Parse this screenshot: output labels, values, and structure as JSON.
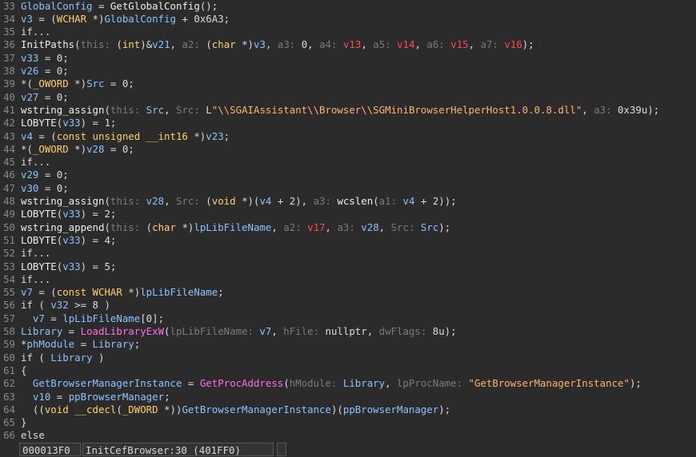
{
  "code_lines": [
    {
      "n": "33",
      "t": [
        [
          "GlobalConfig",
          "var"
        ],
        [
          " = ",
          ""
        ],
        [
          "GetGlobalConfig",
          "func"
        ],
        [
          "();",
          ""
        ]
      ]
    },
    {
      "n": "34",
      "t": [
        [
          "v3",
          "var"
        ],
        [
          " = (",
          ""
        ],
        [
          "WCHAR",
          "type"
        ],
        [
          " *)",
          ""
        ],
        [
          "GlobalConfig",
          "var"
        ],
        [
          " + 0x6A3;",
          ""
        ]
      ]
    },
    {
      "n": "35",
      "t": [
        [
          "if...",
          ""
        ]
      ]
    },
    {
      "n": "36",
      "t": [
        [
          "InitPaths",
          "func"
        ],
        [
          "(",
          ""
        ],
        [
          "this: ",
          "p"
        ],
        [
          "(",
          ""
        ],
        [
          "int",
          "type"
        ],
        [
          ")&",
          ""
        ],
        [
          "v21",
          "var"
        ],
        [
          ", ",
          ""
        ],
        [
          "a2: ",
          "p"
        ],
        [
          "(",
          ""
        ],
        [
          "char",
          "type"
        ],
        [
          " *)",
          ""
        ],
        [
          "v3",
          "var"
        ],
        [
          ", ",
          ""
        ],
        [
          "a3: ",
          "p"
        ],
        [
          "0, ",
          ""
        ],
        [
          "a4: ",
          "p"
        ],
        [
          "v13",
          "redv"
        ],
        [
          ", ",
          ""
        ],
        [
          "a5: ",
          "p"
        ],
        [
          "v14",
          "redv"
        ],
        [
          ", ",
          ""
        ],
        [
          "a6: ",
          "p"
        ],
        [
          "v15",
          "redv"
        ],
        [
          ", ",
          ""
        ],
        [
          "a7: ",
          "p"
        ],
        [
          "v16",
          "redv"
        ],
        [
          ");",
          ""
        ]
      ]
    },
    {
      "n": "37",
      "t": [
        [
          "v33",
          "var"
        ],
        [
          " = 0;",
          ""
        ]
      ]
    },
    {
      "n": "38",
      "t": [
        [
          "v26",
          "var"
        ],
        [
          " = 0;",
          ""
        ]
      ]
    },
    {
      "n": "39",
      "t": [
        [
          "*(",
          ""
        ],
        [
          "_OWORD",
          "type"
        ],
        [
          " *)",
          ""
        ],
        [
          "Src",
          "var"
        ],
        [
          " = 0;",
          ""
        ]
      ]
    },
    {
      "n": "40",
      "t": [
        [
          "v27",
          "var"
        ],
        [
          " = 0;",
          ""
        ]
      ]
    },
    {
      "n": "41",
      "t": [
        [
          "wstring_assign",
          "func"
        ],
        [
          "(",
          ""
        ],
        [
          "this: ",
          "p"
        ],
        [
          "Src",
          "var"
        ],
        [
          ", ",
          ""
        ],
        [
          "Src: ",
          "p"
        ],
        [
          "L",
          ""
        ],
        [
          "\"\\\\SGAIAssistant\\\\Browser\\\\SGMiniBrowserHelperHost1.0.0.8.dll\"",
          "str"
        ],
        [
          ", ",
          ""
        ],
        [
          "a3: ",
          "p"
        ],
        [
          "0x39u);",
          ""
        ]
      ]
    },
    {
      "n": "42",
      "t": [
        [
          "LOBYTE",
          "func"
        ],
        [
          "(",
          ""
        ],
        [
          "v33",
          "var"
        ],
        [
          ") = 1;",
          ""
        ]
      ]
    },
    {
      "n": "43",
      "t": [
        [
          "v4",
          "var"
        ],
        [
          " = (",
          ""
        ],
        [
          "const unsigned __int16",
          "type"
        ],
        [
          " *)",
          ""
        ],
        [
          "v23",
          "var"
        ],
        [
          ";",
          ""
        ]
      ]
    },
    {
      "n": "44",
      "t": [
        [
          "*(",
          ""
        ],
        [
          "_OWORD",
          "type"
        ],
        [
          " *)",
          ""
        ],
        [
          "v28",
          "var"
        ],
        [
          " = 0;",
          ""
        ]
      ]
    },
    {
      "n": "45",
      "t": [
        [
          "if...",
          ""
        ]
      ]
    },
    {
      "n": "46",
      "t": [
        [
          "v29",
          "var"
        ],
        [
          " = 0;",
          ""
        ]
      ]
    },
    {
      "n": "47",
      "t": [
        [
          "v30",
          "var"
        ],
        [
          " = 0;",
          ""
        ]
      ]
    },
    {
      "n": "48",
      "t": [
        [
          "wstring_assign",
          "func"
        ],
        [
          "(",
          ""
        ],
        [
          "this: ",
          "p"
        ],
        [
          "v28",
          "var"
        ],
        [
          ", ",
          ""
        ],
        [
          "Src: ",
          "p"
        ],
        [
          "(",
          ""
        ],
        [
          "void",
          "type"
        ],
        [
          " *)(",
          ""
        ],
        [
          "v4",
          "var"
        ],
        [
          " + 2), ",
          ""
        ],
        [
          "a3: ",
          "p"
        ],
        [
          "wcslen",
          "func"
        ],
        [
          "(",
          ""
        ],
        [
          "a1: ",
          "p"
        ],
        [
          "v4",
          "var"
        ],
        [
          " + 2));",
          ""
        ]
      ]
    },
    {
      "n": "49",
      "t": [
        [
          "LOBYTE",
          "func"
        ],
        [
          "(",
          ""
        ],
        [
          "v33",
          "var"
        ],
        [
          ") = 2;",
          ""
        ]
      ]
    },
    {
      "n": "50",
      "t": [
        [
          "wstring_append",
          "func"
        ],
        [
          "(",
          ""
        ],
        [
          "this: ",
          "p"
        ],
        [
          "(",
          ""
        ],
        [
          "char",
          "type"
        ],
        [
          " *)",
          ""
        ],
        [
          "lpLibFileName",
          "var"
        ],
        [
          ", ",
          ""
        ],
        [
          "a2: ",
          "p"
        ],
        [
          "v17",
          "redv"
        ],
        [
          ", ",
          ""
        ],
        [
          "a3: ",
          "p"
        ],
        [
          "v28",
          "var"
        ],
        [
          ", ",
          ""
        ],
        [
          "Src: ",
          "p"
        ],
        [
          "Src",
          "var"
        ],
        [
          ");",
          ""
        ]
      ]
    },
    {
      "n": "51",
      "t": [
        [
          "LOBYTE",
          "func"
        ],
        [
          "(",
          ""
        ],
        [
          "v33",
          "var"
        ],
        [
          ") = 4;",
          ""
        ]
      ]
    },
    {
      "n": "52",
      "t": [
        [
          "if...",
          ""
        ]
      ]
    },
    {
      "n": "53",
      "t": [
        [
          "LOBYTE",
          "func"
        ],
        [
          "(",
          ""
        ],
        [
          "v33",
          "var"
        ],
        [
          ") = 5;",
          ""
        ]
      ]
    },
    {
      "n": "54",
      "t": [
        [
          "if...",
          ""
        ]
      ]
    },
    {
      "n": "55",
      "t": [
        [
          "v7",
          "var"
        ],
        [
          " = (",
          ""
        ],
        [
          "const WCHAR",
          "type"
        ],
        [
          " *)",
          ""
        ],
        [
          "lpLibFileName",
          "var"
        ],
        [
          ";",
          ""
        ]
      ]
    },
    {
      "n": "56",
      "t": [
        [
          "if ( ",
          ""
        ],
        [
          "v32",
          "var"
        ],
        [
          " >= 8 )",
          ""
        ]
      ]
    },
    {
      "n": "57",
      "t": [
        [
          "  ",
          ""
        ],
        [
          "v7",
          "var"
        ],
        [
          " = ",
          ""
        ],
        [
          "lpLibFileName",
          "var"
        ],
        [
          "[0];",
          ""
        ]
      ]
    },
    {
      "n": "58",
      "t": [
        [
          "Library",
          "var"
        ],
        [
          " = ",
          ""
        ],
        [
          "LoadLibraryExW",
          "import"
        ],
        [
          "(",
          ""
        ],
        [
          "lpLibFileName: ",
          "p"
        ],
        [
          "v7",
          "var"
        ],
        [
          ", ",
          ""
        ],
        [
          "hFile: ",
          "p"
        ],
        [
          "nullptr, ",
          ""
        ],
        [
          "dwFlags: ",
          "p"
        ],
        [
          "8u);",
          ""
        ]
      ]
    },
    {
      "n": "59",
      "t": [
        [
          "*",
          ""
        ],
        [
          "phModule",
          "var"
        ],
        [
          " = ",
          ""
        ],
        [
          "Library",
          "var"
        ],
        [
          ";",
          ""
        ]
      ]
    },
    {
      "n": "60",
      "t": [
        [
          "if ( ",
          ""
        ],
        [
          "Library",
          "var"
        ],
        [
          " )",
          ""
        ]
      ]
    },
    {
      "n": "61",
      "t": [
        [
          "{",
          ""
        ]
      ]
    },
    {
      "n": "62",
      "t": [
        [
          "  ",
          ""
        ],
        [
          "GetBrowserManagerInstance",
          "var"
        ],
        [
          " = ",
          ""
        ],
        [
          "GetProcAddress",
          "import"
        ],
        [
          "(",
          ""
        ],
        [
          "hModule: ",
          "p"
        ],
        [
          "Library",
          "var"
        ],
        [
          ", ",
          ""
        ],
        [
          "lpProcName: ",
          "p"
        ],
        [
          "\"GetBrowserManagerInstance\"",
          "str"
        ],
        [
          ");",
          ""
        ]
      ]
    },
    {
      "n": "63",
      "t": [
        [
          "  ",
          ""
        ],
        [
          "v10",
          "var"
        ],
        [
          " = ",
          ""
        ],
        [
          "ppBrowserManager",
          "var"
        ],
        [
          ";",
          ""
        ]
      ]
    },
    {
      "n": "64",
      "t": [
        [
          "  ((",
          ""
        ],
        [
          "void __cdecl",
          "type"
        ],
        [
          "(",
          ""
        ],
        [
          "_DWORD",
          "type"
        ],
        [
          " *))",
          ""
        ],
        [
          "GetBrowserManagerInstance",
          "var"
        ],
        [
          ")(",
          ""
        ],
        [
          "ppBrowserManager",
          "var"
        ],
        [
          ");",
          ""
        ]
      ]
    },
    {
      "n": "65",
      "t": [
        [
          "}",
          ""
        ]
      ]
    },
    {
      "n": "66",
      "t": [
        [
          "else",
          ""
        ]
      ]
    }
  ],
  "status": {
    "address": "000013F0",
    "location": "InitCefBrowser:30 (401FF0)"
  }
}
